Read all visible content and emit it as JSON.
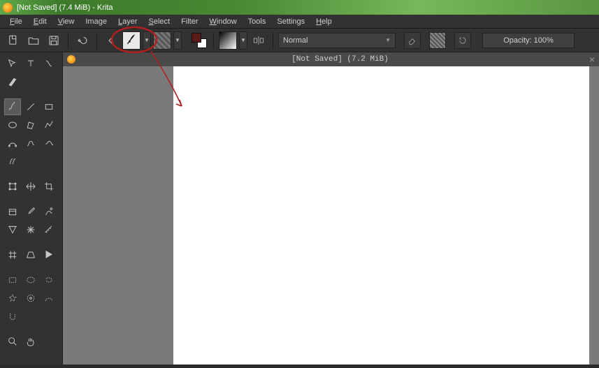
{
  "title": "[Not Saved]  (7.4 MiB)  - Krita",
  "menu": {
    "file": "File",
    "edit": "Edit",
    "view": "View",
    "image": "Image",
    "layer": "Layer",
    "select": "Select",
    "filter": "Filter",
    "window": "Window",
    "tools": "Tools",
    "settings": "Settings",
    "help": "Help"
  },
  "toolbar": {
    "blend_mode": "Normal",
    "opacity_label": "Opacity:  100%"
  },
  "document": {
    "tab_title": "[Not Saved]   (7.2 MiB)"
  },
  "colors": {
    "fg": "#5a1a1a",
    "bg": "#ffffff"
  }
}
